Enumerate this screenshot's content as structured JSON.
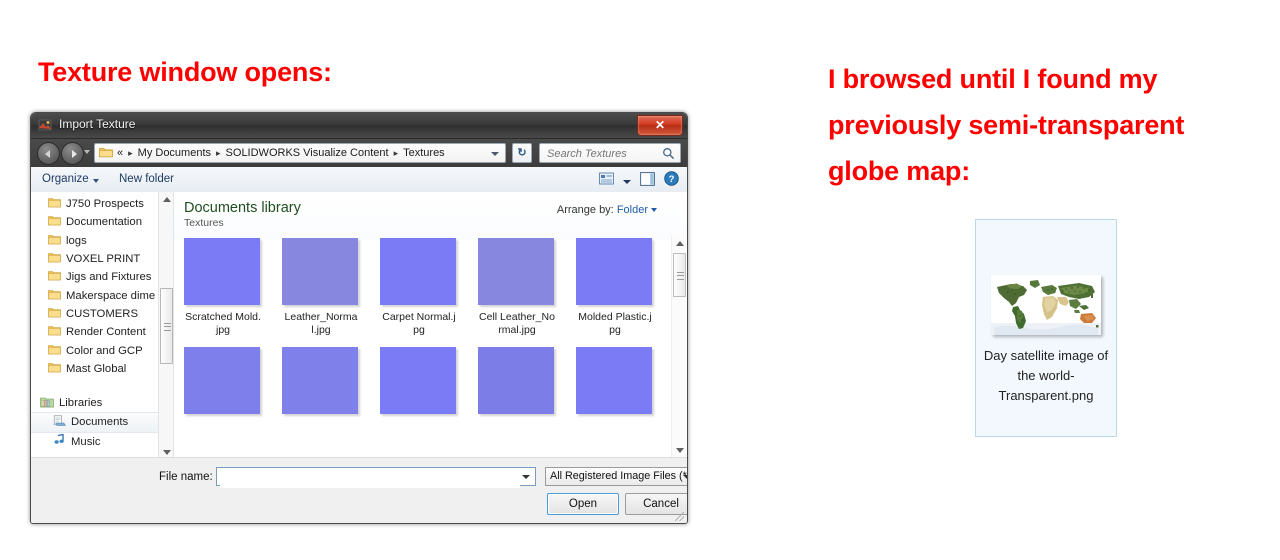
{
  "headings": {
    "left": "Texture window opens:",
    "right": "I browsed until I found my previously semi-transparent globe map:"
  },
  "dialog": {
    "title": "Import Texture",
    "title_icon": "import-texture-icon",
    "close_label": "✕",
    "nav": {
      "back_icon": "back-arrow-icon",
      "forward_icon": "forward-arrow-icon",
      "history_dropdown_icon": "chevron-down-icon",
      "folder_icon": "folder-icon",
      "breadcrumbs": [
        "«",
        "My Documents",
        "SOLIDWORKS Visualize Content",
        "Textures"
      ],
      "separator": "▸",
      "address_dropdown_icon": "chevron-down-icon",
      "refresh_label": "↻",
      "refresh_icon": "refresh-icon",
      "search_placeholder": "Search Textures",
      "search_value": "",
      "search_icon": "search-icon"
    },
    "commandbar": {
      "organize": "Organize",
      "organize_caret_icon": "chevron-down-icon",
      "new_folder": "New folder",
      "view_icon": "view-mode-icon",
      "view_caret_icon": "chevron-down-icon",
      "preview_pane_icon": "preview-pane-icon",
      "help_icon": "help-icon"
    },
    "sidebar": {
      "folders": [
        "J750 Prospects",
        "Documentation",
        "logs",
        "VOXEL PRINT",
        "Jigs and Fixtures",
        "Makerspace dime",
        "CUSTOMERS",
        "Render Content",
        "Color and GCP",
        "Mast Global"
      ],
      "libraries_group": "Libraries",
      "libraries_icon": "libraries-icon",
      "library_items": [
        {
          "label": "Documents",
          "icon": "documents-icon",
          "selected": true
        },
        {
          "label": "Music",
          "icon": "music-icon",
          "selected": false
        }
      ],
      "scroll_up_icon": "scroll-up-arrow-icon",
      "scroll_down_icon": "scroll-down-arrow-icon"
    },
    "content": {
      "library_title": "Documents library",
      "library_subtitle": "Textures",
      "arrange_label": "Arrange by:",
      "arrange_value": "Folder",
      "arrange_caret_icon": "chevron-down-icon",
      "files_row1": [
        {
          "name": "Scratched Mold.jpg",
          "style": "plain"
        },
        {
          "name": "Leather_Normal.jpg",
          "style": "noisy"
        },
        {
          "name": "Carpet Normal.jpg",
          "style": "plain"
        },
        {
          "name": "Cell Leather_Normal.jpg",
          "style": "noisy"
        },
        {
          "name": "Molded Plastic.jpg",
          "style": "plain"
        }
      ],
      "files_row2": [
        {
          "name": "",
          "style": "noisy2"
        },
        {
          "name": "",
          "style": "noisy3"
        },
        {
          "name": "",
          "style": "plain"
        },
        {
          "name": "",
          "style": "lines"
        },
        {
          "name": "",
          "style": "plain"
        }
      ],
      "scroll_up_icon": "scroll-up-arrow-icon",
      "scroll_down_icon": "scroll-down-arrow-icon"
    },
    "footer": {
      "filename_label": "File name:",
      "filename_value": "",
      "filename_caret_icon": "chevron-down-icon",
      "filter_value": "All Registered Image Files (*",
      "filter_caret_icon": "chevron-down-icon",
      "open_label": "Open",
      "cancel_label": "Cancel",
      "resize_grip_icon": "resize-grip-icon"
    }
  },
  "selected_file": {
    "thumbnail_icon": "world-map-thumbnail",
    "caption": "Day satellite image of the world-Transparent.png"
  },
  "colors": {
    "heading_red": "#FF0000",
    "normal_map_blue": "#7B7BF5",
    "library_title_green": "#1F4F20",
    "link_blue": "#1F5CA8",
    "selection_blue": "#F2F8FD"
  }
}
